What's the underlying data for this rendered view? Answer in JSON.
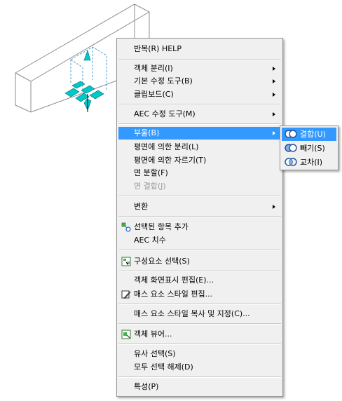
{
  "menu": {
    "items": [
      {
        "label": "반복(R) HELP"
      },
      {
        "label": "객체 분리(I)"
      },
      {
        "label": "기본 수정 도구(B)"
      },
      {
        "label": "클립보드(C)"
      },
      {
        "label": "AEC 수정 도구(M)"
      },
      {
        "label": "부울(B)"
      },
      {
        "label": "평면에 의한 분리(L)"
      },
      {
        "label": "평면에 의한 자르기(T)"
      },
      {
        "label": "면 분할(F)"
      },
      {
        "label": "면 결합(J)"
      },
      {
        "label": "변환"
      },
      {
        "label": "선택된 항목 추가"
      },
      {
        "label": "AEC 치수"
      },
      {
        "label": "구성요소 선택(S)"
      },
      {
        "label": "객체 화면표시 편집(E)..."
      },
      {
        "label": "매스 요소 스타일 편집..."
      },
      {
        "label": "매스 요소 스타일 복사 및 지정(C)..."
      },
      {
        "label": "객체 뷰어..."
      },
      {
        "label": "유사 선택(S)"
      },
      {
        "label": "모두 선택 해제(D)"
      },
      {
        "label": "특성(P)"
      }
    ]
  },
  "submenu": {
    "items": [
      {
        "label": "결합(U)"
      },
      {
        "label": "빼기(S)"
      },
      {
        "label": "교차(I)"
      }
    ]
  },
  "colors": {
    "highlight": "#3399ff",
    "menu_bg": "#f0f0f0",
    "object": "#00c8c8"
  }
}
